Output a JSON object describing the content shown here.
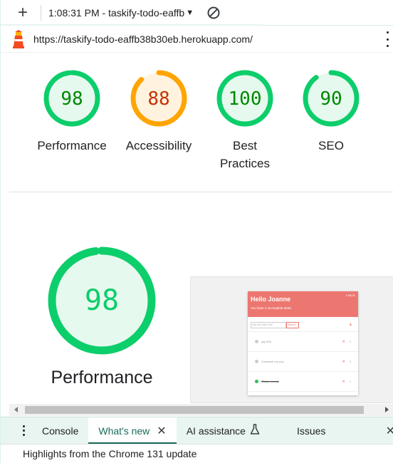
{
  "toolbar": {
    "report_label": "1:08:31 PM - taskify-todo-eaffb",
    "new_icon": "plus-icon",
    "caret_icon": "caret-down-icon",
    "clear_icon": "block-icon"
  },
  "urlbar": {
    "url": "https://taskify-todo-eaffb38b30eb.herokuapp.com/",
    "logo_icon": "lighthouse-icon",
    "menu_icon": "kebab-menu-icon"
  },
  "scores": [
    {
      "label": "Performance",
      "value": "98",
      "color": "#0cce6b",
      "text_color": "#008800",
      "fill": "#e6f9ee"
    },
    {
      "label": "Accessibility",
      "value": "88",
      "color": "#ffa400",
      "text_color": "#c33300",
      "fill": "#fff3e0"
    },
    {
      "label": "Best Practices",
      "value": "100",
      "color": "#0cce6b",
      "text_color": "#008800",
      "fill": "#e6f9ee"
    },
    {
      "label": "SEO",
      "value": "90",
      "color": "#0cce6b",
      "text_color": "#008800",
      "fill": "#e6f9ee"
    }
  ],
  "performance": {
    "label": "Performance",
    "value": "98",
    "color": "#0cce6b",
    "text_color": "#0cce6b"
  },
  "thumbnail": {
    "greeting": "Hello Joanne",
    "subtitle": "You have 2 incomplete tasks",
    "time": "1:08:31",
    "input_placeholder": "Add new task here",
    "submit_label": "Submit",
    "add_symbol": "+",
    "tasks": [
      {
        "text": "jog 40m",
        "count": "2"
      },
      {
        "text": "Complete my proj",
        "count": "3"
      },
      {
        "text": "Study meetup",
        "count": "4"
      }
    ]
  },
  "drawer": {
    "tabs": [
      {
        "label": "Console"
      },
      {
        "label": "What's new"
      },
      {
        "label": "AI assistance"
      },
      {
        "label": "Issues"
      }
    ],
    "close_symbol": "✕",
    "end_close_symbol": "✕",
    "highlights": "Highlights from the Chrome 131 update"
  }
}
